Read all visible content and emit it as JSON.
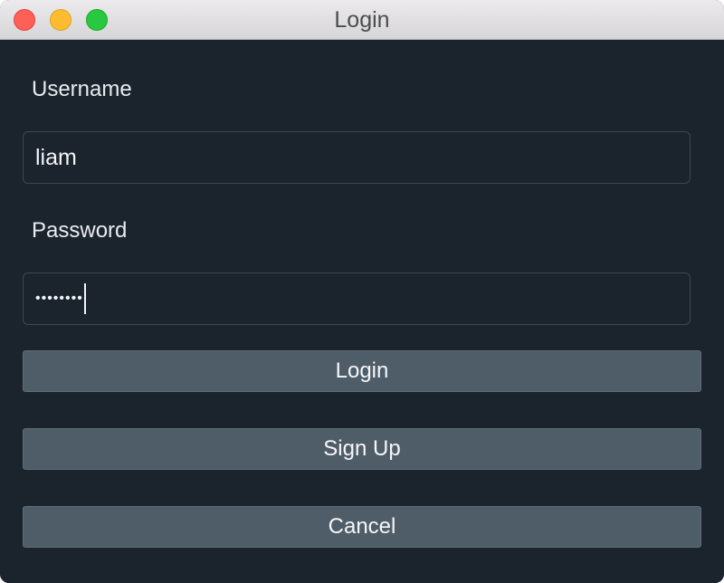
{
  "window": {
    "title": "Login"
  },
  "form": {
    "username_label": "Username",
    "username_value": "liam",
    "password_label": "Password",
    "password_masked": "••••••••"
  },
  "buttons": {
    "login": "Login",
    "signup": "Sign Up",
    "cancel": "Cancel"
  },
  "colors": {
    "background": "#1b232d",
    "button": "#4f5d69",
    "text": "#f2f4f6",
    "close": "#fe5f57",
    "minimize": "#febc2e",
    "zoom": "#28c840"
  }
}
